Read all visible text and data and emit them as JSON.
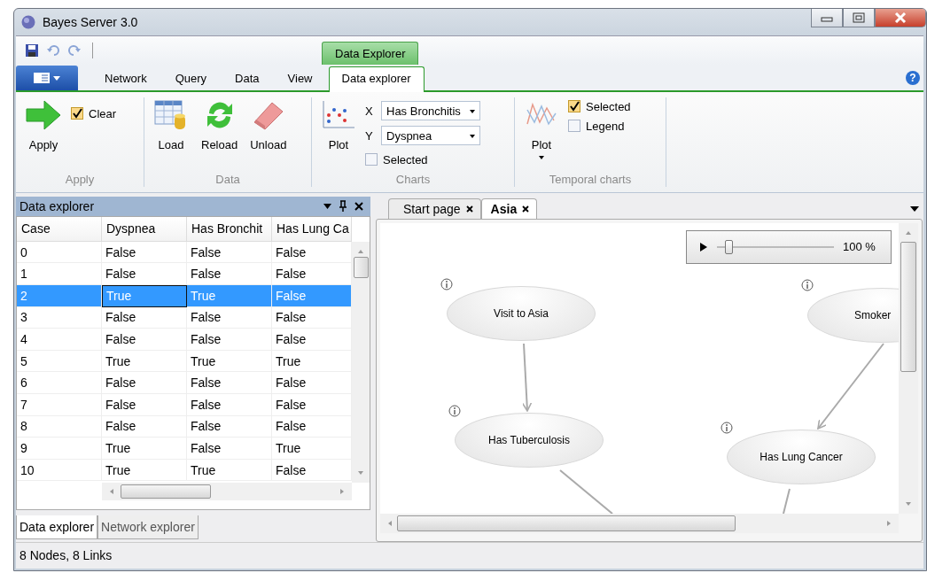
{
  "window": {
    "title": "Bayes Server 3.0"
  },
  "contextual_tab": {
    "label": "Data Explorer"
  },
  "ribbon_tabs": [
    {
      "label": "Network",
      "selected": false
    },
    {
      "label": "Query",
      "selected": false
    },
    {
      "label": "Data",
      "selected": false
    },
    {
      "label": "View",
      "selected": false
    },
    {
      "label": "Data explorer",
      "selected": true
    }
  ],
  "help": {
    "label": "?"
  },
  "ribbon": {
    "apply_group": {
      "title": "Apply",
      "apply_button": "Apply",
      "clear": {
        "label": "Clear",
        "checked": true
      }
    },
    "data_group": {
      "title": "Data",
      "buttons": [
        "Load",
        "Reload",
        "Unload"
      ]
    },
    "charts_group": {
      "title": "Charts",
      "plot_button": "Plot",
      "axes": [
        {
          "axis": "X",
          "value": "Has Bronchitis"
        },
        {
          "axis": "Y",
          "value": "Dyspnea"
        }
      ],
      "selected": {
        "label": "Selected",
        "checked": false
      }
    },
    "temporal_group": {
      "title": "Temporal charts",
      "plot_button": "Plot",
      "options": [
        {
          "label": "Selected",
          "checked": true
        },
        {
          "label": "Legend",
          "checked": false
        }
      ]
    }
  },
  "data_explorer": {
    "title": "Data explorer",
    "columns": [
      "Case",
      "Dyspnea",
      "Has Bronchit",
      "Has Lung Ca"
    ],
    "rows": [
      {
        "cells": [
          "0",
          "False",
          "False",
          "False"
        ],
        "selected": false
      },
      {
        "cells": [
          "1",
          "False",
          "False",
          "False"
        ],
        "selected": false
      },
      {
        "cells": [
          "2",
          "True",
          "True",
          "False"
        ],
        "selected": true
      },
      {
        "cells": [
          "3",
          "False",
          "False",
          "False"
        ],
        "selected": false
      },
      {
        "cells": [
          "4",
          "False",
          "False",
          "False"
        ],
        "selected": false
      },
      {
        "cells": [
          "5",
          "True",
          "True",
          "True"
        ],
        "selected": false
      },
      {
        "cells": [
          "6",
          "False",
          "False",
          "False"
        ],
        "selected": false
      },
      {
        "cells": [
          "7",
          "False",
          "False",
          "False"
        ],
        "selected": false
      },
      {
        "cells": [
          "8",
          "False",
          "False",
          "False"
        ],
        "selected": false
      },
      {
        "cells": [
          "9",
          "True",
          "False",
          "True"
        ],
        "selected": false
      },
      {
        "cells": [
          "10",
          "True",
          "True",
          "False"
        ],
        "selected": false
      }
    ],
    "tabs": [
      {
        "label": "Data explorer",
        "selected": true
      },
      {
        "label": "Network explorer",
        "selected": false
      }
    ]
  },
  "document_tabs": [
    {
      "label": "Start page",
      "selected": false
    },
    {
      "label": "Asia",
      "selected": true
    }
  ],
  "zoom": {
    "level": 0.1,
    "reading": "100 %"
  },
  "network": {
    "nodes": [
      "Visit to Asia",
      "Has Tuberculosis",
      "Smoker",
      "Has Lung Cancer"
    ]
  },
  "status_bar": "8 Nodes, 8 Links"
}
